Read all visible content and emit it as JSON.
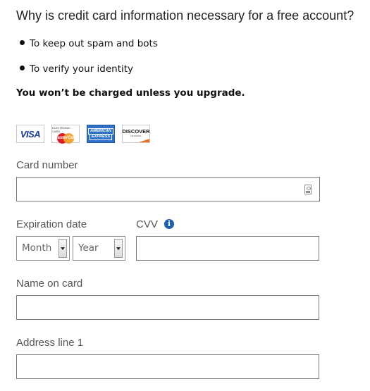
{
  "heading": "Why is credit card information necessary for a free account?",
  "reasons": [
    "To keep out spam and bots",
    "To verify your identity"
  ],
  "notice": "You won’t be charged unless you upgrade.",
  "cards": {
    "visa": "VISA",
    "mastercard": "MasterCard",
    "mastercard_top": "ELECTRONIC CARD",
    "amex_line1": "AMERICAN",
    "amex_line2": "EXPRESS",
    "discover": "DISCOVER",
    "discover_sub": "NETWORK"
  },
  "form": {
    "card_number_label": "Card number",
    "card_number_value": "",
    "expiration_label": "Expiration date",
    "month_selected": "Month",
    "year_selected": "Year",
    "cvv_label": "CVV",
    "cvv_value": "",
    "name_label": "Name on card",
    "name_value": "",
    "address1_label": "Address line 1",
    "address1_value": ""
  },
  "icons": {
    "info": "info-icon",
    "contact_card": "contact-card-icon",
    "dropdown": "chevron-down-icon"
  },
  "colors": {
    "info_blue": "#1f5fb0",
    "amex_blue": "#2c71c7",
    "visa_blue": "#1a3b8c",
    "discover_orange": "#e9731e"
  }
}
